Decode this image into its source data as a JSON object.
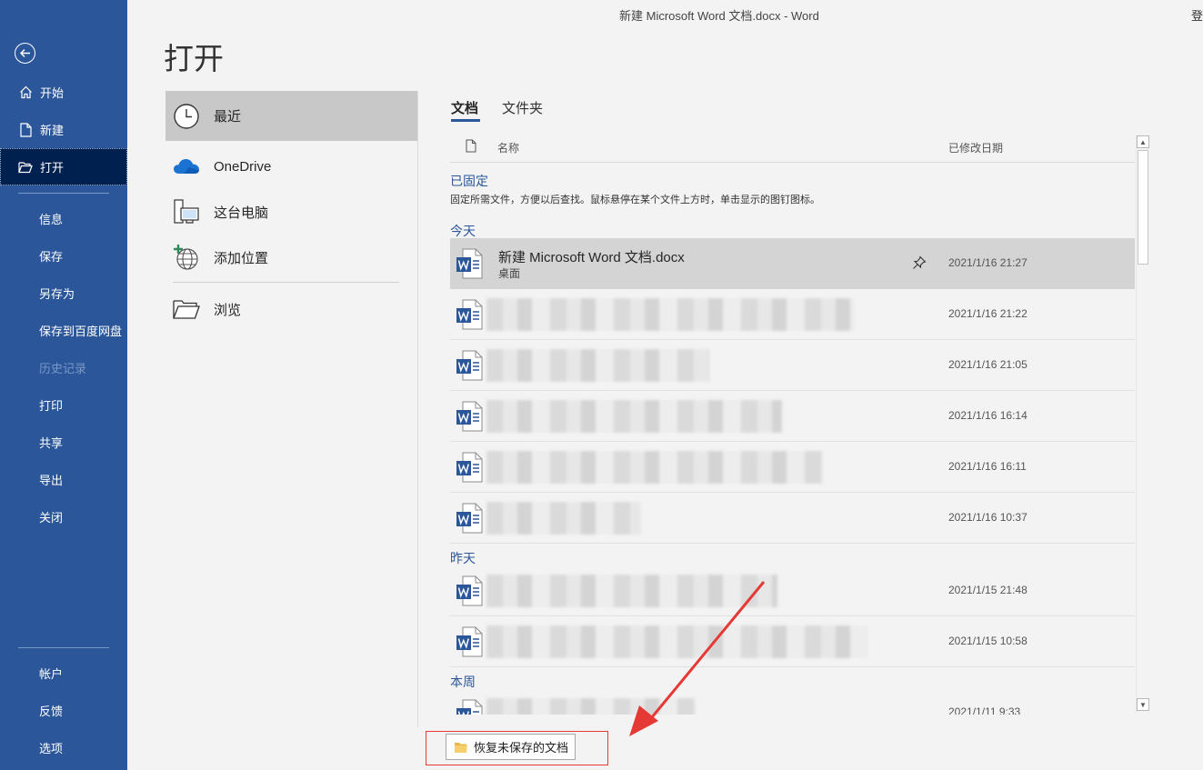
{
  "window": {
    "title": "新建 Microsoft Word 文档.docx  -  Word",
    "title_right": "登"
  },
  "sidebar": {
    "items": [
      {
        "label": "开始"
      },
      {
        "label": "新建"
      },
      {
        "label": "打开"
      },
      {
        "label": "信息"
      },
      {
        "label": "保存"
      },
      {
        "label": "另存为"
      },
      {
        "label": "保存到百度网盘"
      },
      {
        "label": "历史记录"
      },
      {
        "label": "打印"
      },
      {
        "label": "共享"
      },
      {
        "label": "导出"
      },
      {
        "label": "关闭"
      },
      {
        "label": "帐户"
      },
      {
        "label": "反馈"
      },
      {
        "label": "选项"
      }
    ]
  },
  "page": {
    "title": "打开"
  },
  "locations": [
    {
      "label": "最近"
    },
    {
      "label": "OneDrive"
    },
    {
      "label": "这台电脑"
    },
    {
      "label": "添加位置"
    },
    {
      "label": "浏览"
    }
  ],
  "tabs": [
    {
      "label": "文档"
    },
    {
      "label": "文件夹"
    }
  ],
  "list": {
    "col_name": "名称",
    "col_date": "已修改日期",
    "groups": {
      "pinned": "已固定",
      "pinned_hint": "固定所需文件，方便以后查找。鼠标悬停在某个文件上方时，单击显示的图钉图标。",
      "today": "今天",
      "yesterday": "昨天",
      "this_week": "本周"
    },
    "rows": [
      {
        "name": "新建 Microsoft Word 文档.docx",
        "location": "桌面",
        "date": "2021/1/16 21:27"
      },
      {
        "name": "",
        "location": "",
        "date": "2021/1/16 21:22"
      },
      {
        "name": "",
        "location": "",
        "date": "2021/1/16 21:05"
      },
      {
        "name": "",
        "location": "",
        "date": "2021/1/16 16:14"
      },
      {
        "name": "",
        "location": "",
        "date": "2021/1/16 16:11"
      },
      {
        "name": "",
        "location": "",
        "date": "2021/1/16 10:37"
      },
      {
        "name": "",
        "location": "",
        "date": "2021/1/15 21:48"
      },
      {
        "name": "",
        "location": "",
        "date": "2021/1/15 10:58"
      },
      {
        "name": "",
        "location": "",
        "date": "2021/1/11 9:33"
      }
    ]
  },
  "recover": {
    "label": "恢复未保存的文档"
  },
  "colors": {
    "brand": "#2b579a",
    "active_nav": "#002050",
    "annotation": "#e53935"
  }
}
